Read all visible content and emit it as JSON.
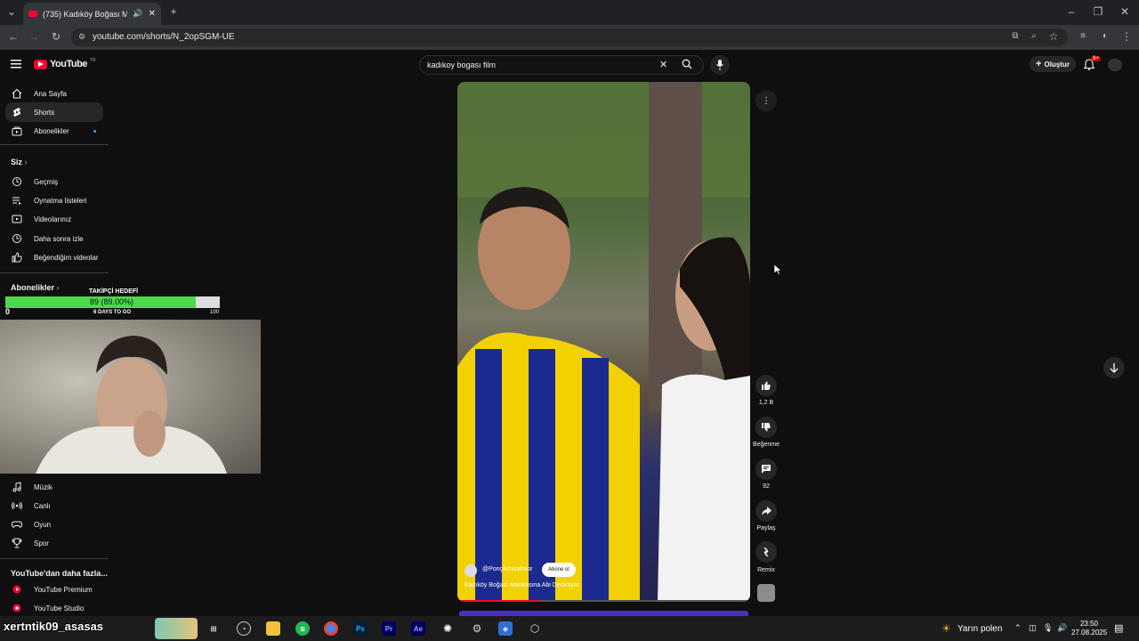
{
  "browser": {
    "tab_title": "(735) Kadıköy Boğası Manit...",
    "url": "youtube.com/shorts/N_2opSGM-UE"
  },
  "header": {
    "logo_text": "YouTube",
    "logo_sup": "TR",
    "search_value": "kadıkoy bogası film",
    "create_label": "Oluştur",
    "notif_badge": "9+"
  },
  "sidebar": {
    "main": [
      {
        "label": "Ana Sayfa",
        "icon": "home-icon"
      },
      {
        "label": "Shorts",
        "icon": "shorts-icon"
      },
      {
        "label": "Abonelikler",
        "icon": "subscriptions-icon"
      }
    ],
    "you_header": "Siz",
    "you": [
      {
        "label": "Geçmiş",
        "icon": "history-icon"
      },
      {
        "label": "Oynatma listeleri",
        "icon": "playlists-icon"
      },
      {
        "label": "Videolarınız",
        "icon": "your-videos-icon"
      },
      {
        "label": "Daha sonra izle",
        "icon": "watch-later-icon"
      },
      {
        "label": "Beğendiğim videolar",
        "icon": "liked-icon"
      }
    ],
    "subs_header": "Abonelikler",
    "explore": [
      {
        "label": "Müzik",
        "icon": "music-icon"
      },
      {
        "label": "Canlı",
        "icon": "live-icon"
      },
      {
        "label": "Oyun",
        "icon": "gaming-icon"
      },
      {
        "label": "Spor",
        "icon": "sports-icon"
      }
    ],
    "more_header": "YouTube'dan daha fazla...",
    "more": [
      {
        "label": "YouTube Premium",
        "icon": "youtube-premium-icon"
      },
      {
        "label": "YouTube Studio",
        "icon": "youtube-studio-icon"
      }
    ]
  },
  "follower_goal": {
    "title": "TAKİPÇİ HEDEFİ",
    "value_text": "89 (89.00%)",
    "progress": 0.89,
    "days_left": "6 DAYS TO GO",
    "start": "0",
    "target": "100"
  },
  "short": {
    "channel": "@Ponçikmizahsor",
    "subscribe_label": "Abone ol",
    "caption": "Kadıköy Boğası Manitasına Abi Dedirtiyor",
    "likes": "1,2 B",
    "dislike_label": "Beğenme",
    "comments": "92",
    "share_label": "Paylaş",
    "remix_label": "Remix"
  },
  "taskbar": {
    "streamer_overlay": "xertntik09_asasas",
    "weather": "Yarın polen",
    "time": "23:50",
    "date": "27.08.2025"
  },
  "colors": {
    "accent": "#ff0033",
    "progress_green": "#4cd94c"
  }
}
